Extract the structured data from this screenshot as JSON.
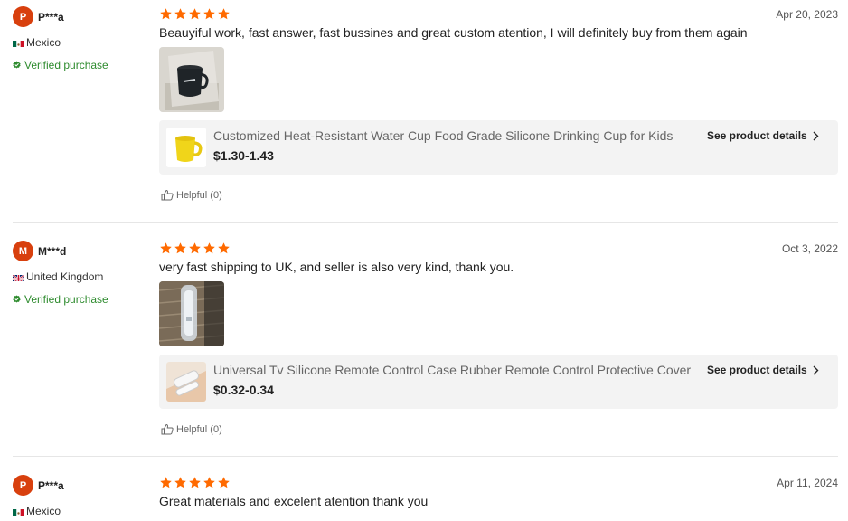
{
  "colors": {
    "accent": "#d8400e",
    "star": "#ff6a00",
    "verified": "#2e8b2e"
  },
  "reviews": [
    {
      "avatar_initial": "P",
      "username": "P***a",
      "country": "Mexico",
      "flag": "mexico-flag",
      "verified": "Verified purchase",
      "stars": 5,
      "date": "Apr 20, 2023",
      "text": "Beauyiful work, fast answer, fast bussines and great custom atention, I will definitely buy from them again",
      "product": {
        "title": "Customized Heat-Resistant Water Cup Food Grade Silicone Drinking Cup for Kids",
        "price": "$1.30-1.43",
        "details_label": "See product details"
      },
      "helpful": "Helpful (0)"
    },
    {
      "avatar_initial": "M",
      "username": "M***d",
      "country": "United Kingdom",
      "flag": "uk-flag",
      "verified": "Verified purchase",
      "stars": 5,
      "date": "Oct 3, 2022",
      "text": "very fast shipping to UK, and seller is also very kind, thank you.",
      "product": {
        "title": "Universal Tv Silicone Remote Control Case Rubber Remote Control Protective Cover",
        "price": "$0.32-0.34",
        "details_label": "See product details"
      },
      "helpful": "Helpful (0)"
    },
    {
      "avatar_initial": "P",
      "username": "P***a",
      "country": "Mexico",
      "flag": "mexico-flag",
      "stars": 5,
      "date": "Apr 11, 2024",
      "text": "Great materials and excelent atention thank you"
    }
  ]
}
